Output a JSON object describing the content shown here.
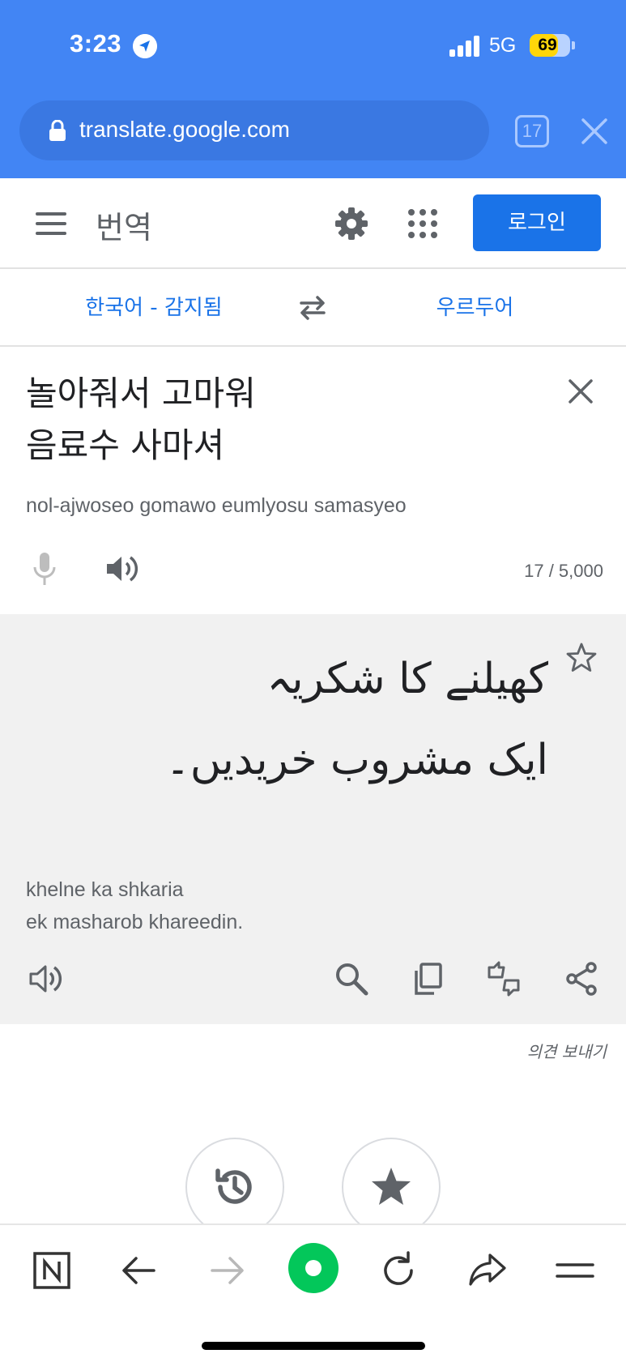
{
  "status_bar": {
    "time": "3:23",
    "network": "5G",
    "battery": "69",
    "battery_level": 0.69
  },
  "browser": {
    "url": "translate.google.com",
    "tab_count": "17"
  },
  "header": {
    "title": "번역",
    "login_label": "로그인"
  },
  "languages": {
    "source": "한국어 - 감지됨",
    "target": "우르두어"
  },
  "source": {
    "lines": [
      "놀아줘서 고마워",
      "음료수 사마셔"
    ],
    "transliteration": "nol-ajwoseo gomawo eumlyosu samasyeo",
    "char_count": "17 / 5,000"
  },
  "translation": {
    "lines": [
      "کھیلنے کا شکریہ",
      "ایک مشروب خریدیں۔"
    ],
    "transliteration_lines": [
      "khelne ka shkaria",
      "ek masharob khareedin."
    ]
  },
  "feedback_label": "의견 보내기",
  "colors": {
    "brand_blue": "#4285f4",
    "accent": "#1a73e8",
    "panel_gray": "#f1f1f1",
    "naver_green": "#03c75a"
  },
  "icons": {
    "status": [
      "location-arrow-icon",
      "signal-icon",
      "battery-icon"
    ],
    "header": [
      "menu-icon",
      "gear-icon",
      "apps-grid-icon"
    ],
    "source": [
      "clear-icon",
      "mic-icon",
      "speaker-icon"
    ],
    "target": [
      "star-icon",
      "speaker-icon",
      "search-icon",
      "copy-icon",
      "feedback-thumbs-icon",
      "share-icon"
    ],
    "floating": [
      "history-icon",
      "saved-star-icon"
    ],
    "browser_nav": [
      "naver-n-icon",
      "back-arrow-icon",
      "forward-arrow-icon",
      "green-dot-icon",
      "reload-icon",
      "share-arrow-icon",
      "hamburger-icon"
    ]
  }
}
